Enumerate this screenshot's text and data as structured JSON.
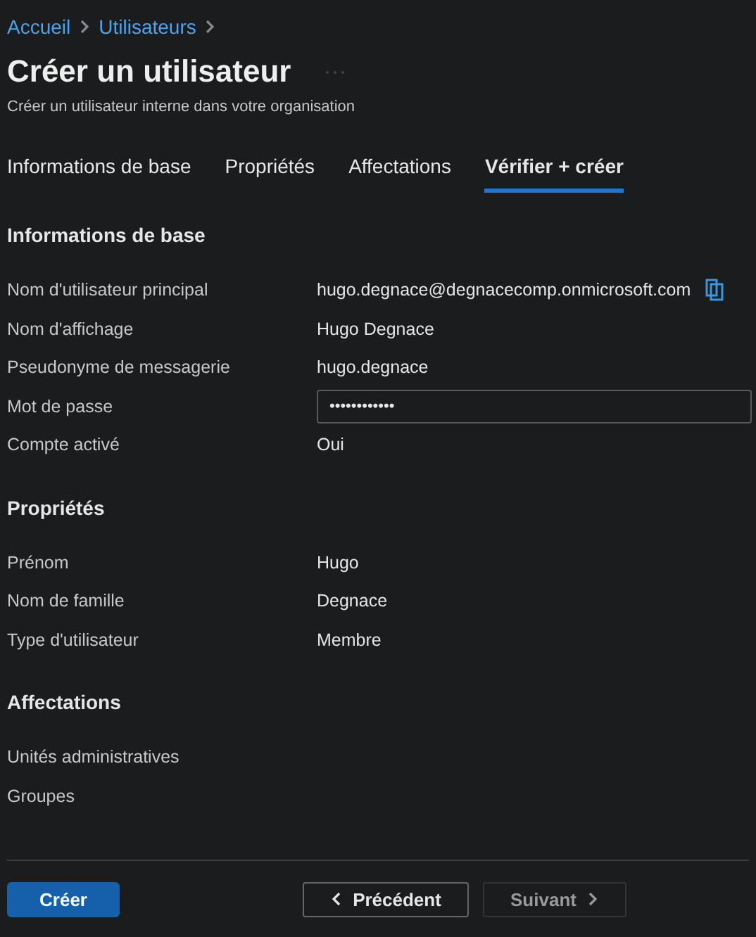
{
  "breadcrumb": [
    "Accueil",
    "Utilisateurs"
  ],
  "title": "Créer un utilisateur",
  "subtitle": "Créer un utilisateur interne dans votre organisation",
  "tabs": [
    {
      "label": "Informations de base",
      "selected": false
    },
    {
      "label": "Propriétés",
      "selected": false
    },
    {
      "label": "Affectations",
      "selected": false
    },
    {
      "label": "Vérifier + créer",
      "selected": true
    }
  ],
  "sections": [
    {
      "heading": "Informations de base",
      "rows": [
        {
          "kind": "copy",
          "label": "Nom d'utilisateur principal",
          "value": "hugo.degnace@degnacecomp.onmicrosoft.com"
        },
        {
          "kind": "text",
          "label": "Nom d'affichage",
          "value": "Hugo Degnace"
        },
        {
          "kind": "text",
          "label": "Pseudonyme de messagerie",
          "value": "hugo.degnace"
        },
        {
          "kind": "password",
          "label": "Mot de passe",
          "value": "••••••••••••"
        },
        {
          "kind": "text",
          "label": "Compte activé",
          "value": "Oui"
        }
      ]
    },
    {
      "heading": "Propriétés",
      "rows": [
        {
          "kind": "text",
          "label": "Prénom",
          "value": "Hugo"
        },
        {
          "kind": "text",
          "label": "Nom de famille",
          "value": "Degnace"
        },
        {
          "kind": "text",
          "label": "Type d'utilisateur",
          "value": "Membre"
        }
      ]
    },
    {
      "heading": "Affectations",
      "rows": [
        {
          "label": "Unités administratives"
        },
        {
          "label": "Groupes"
        }
      ]
    }
  ],
  "footer": {
    "create": "Créer",
    "previous": "Précédent",
    "next": "Suivant",
    "next_disabled": true
  }
}
